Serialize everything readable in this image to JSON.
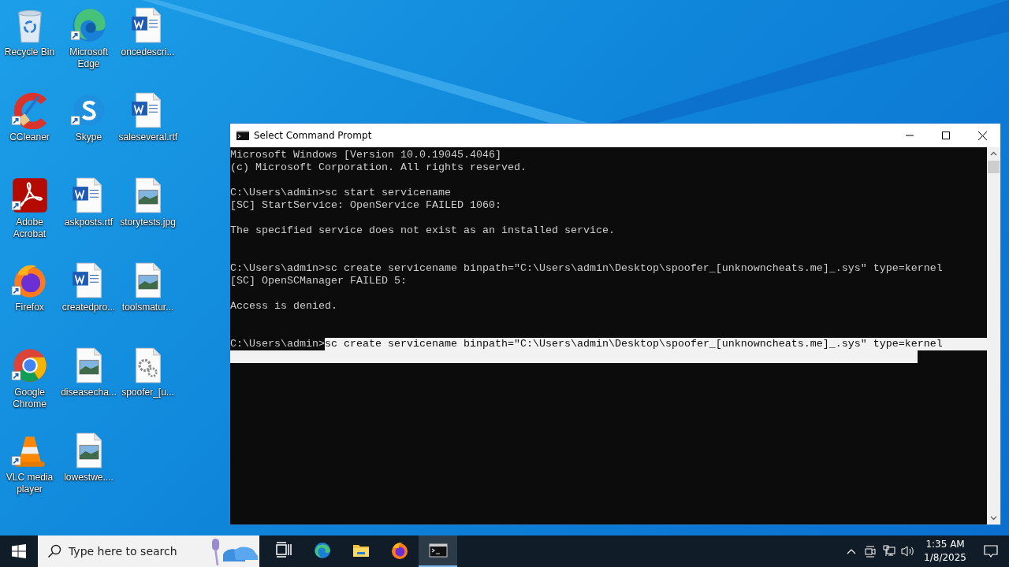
{
  "desktop_icons": [
    {
      "kind": "recycle",
      "label": "Recycle Bin",
      "shortcut": false
    },
    {
      "kind": "ccleaner",
      "label": "CCleaner",
      "shortcut": true
    },
    {
      "kind": "acrobat",
      "label": "Adobe Acrobat",
      "shortcut": true
    },
    {
      "kind": "firefox",
      "label": "Firefox",
      "shortcut": true
    },
    {
      "kind": "chrome",
      "label": "Google Chrome",
      "shortcut": true
    },
    {
      "kind": "vlc",
      "label": "VLC media player",
      "shortcut": true
    },
    {
      "kind": "edge",
      "label": "Microsoft Edge",
      "shortcut": true
    },
    {
      "kind": "skype",
      "label": "Skype",
      "shortcut": true
    },
    {
      "kind": "word",
      "label": "askposts.rtf",
      "shortcut": false
    },
    {
      "kind": "word",
      "label": "createdpro...",
      "shortcut": false
    },
    {
      "kind": "image",
      "label": "diseasecha...",
      "shortcut": false
    },
    {
      "kind": "image",
      "label": "lowestwe....",
      "shortcut": false
    },
    {
      "kind": "word",
      "label": "oncedescri...",
      "shortcut": false
    },
    {
      "kind": "word",
      "label": "saleseveral.rtf",
      "shortcut": false
    },
    {
      "kind": "image",
      "label": "storytests.jpg",
      "shortcut": false
    },
    {
      "kind": "image",
      "label": "toolsmatur...",
      "shortcut": false
    },
    {
      "kind": "gearfile",
      "label": "spoofer_[u...",
      "shortcut": false
    }
  ],
  "window": {
    "title": "Select Command Prompt",
    "console_lines": [
      {
        "kind": "text",
        "segments": [
          {
            "text": "Microsoft Windows [Version 10.0.19045.4046]",
            "selected": false
          }
        ]
      },
      {
        "kind": "text",
        "segments": [
          {
            "text": "(c) Microsoft Corporation. All rights reserved.",
            "selected": false
          }
        ]
      },
      {
        "kind": "blank"
      },
      {
        "kind": "text",
        "segments": [
          {
            "text": "C:\\Users\\admin>sc start servicename",
            "selected": false
          }
        ]
      },
      {
        "kind": "text",
        "segments": [
          {
            "text": "[SC] StartService: OpenService FAILED 1060:",
            "selected": false
          }
        ]
      },
      {
        "kind": "blank"
      },
      {
        "kind": "text",
        "segments": [
          {
            "text": "The specified service does not exist as an installed service.",
            "selected": false
          }
        ]
      },
      {
        "kind": "blank"
      },
      {
        "kind": "blank"
      },
      {
        "kind": "text",
        "segments": [
          {
            "text": "C:\\Users\\admin>sc create servicename binpath=\"C:\\Users\\admin\\Desktop\\spoofer_[unknowncheats.me]_.sys\" type=kernel",
            "selected": false
          }
        ]
      },
      {
        "kind": "text",
        "segments": [
          {
            "text": "[SC] OpenSCManager FAILED 5:",
            "selected": false
          }
        ]
      },
      {
        "kind": "blank"
      },
      {
        "kind": "text",
        "segments": [
          {
            "text": "Access is denied.",
            "selected": false
          }
        ]
      },
      {
        "kind": "blank"
      },
      {
        "kind": "blank"
      },
      {
        "kind": "text",
        "segments": [
          {
            "text": "C:\\Users\\admin>",
            "selected": false
          },
          {
            "text": "sc create servicename binpath=\"C:\\Users\\admin\\Desktop\\spoofer_[unknowncheats.me]_.sys\" type=kernel",
            "selected": true
          }
        ]
      },
      {
        "kind": "selection",
        "level": 0.908
      }
    ]
  },
  "taskbar": {
    "search": {
      "placeholder": "Type here to search"
    },
    "apps": [
      {
        "kind": "taskview",
        "selected": false
      },
      {
        "kind": "edge",
        "selected": false
      },
      {
        "kind": "explorer",
        "selected": false
      },
      {
        "kind": "firefox",
        "selected": false
      },
      {
        "kind": "cmd",
        "selected": true
      }
    ],
    "clock": {
      "time": "1:35 AM",
      "date": "1/8/2025"
    }
  }
}
